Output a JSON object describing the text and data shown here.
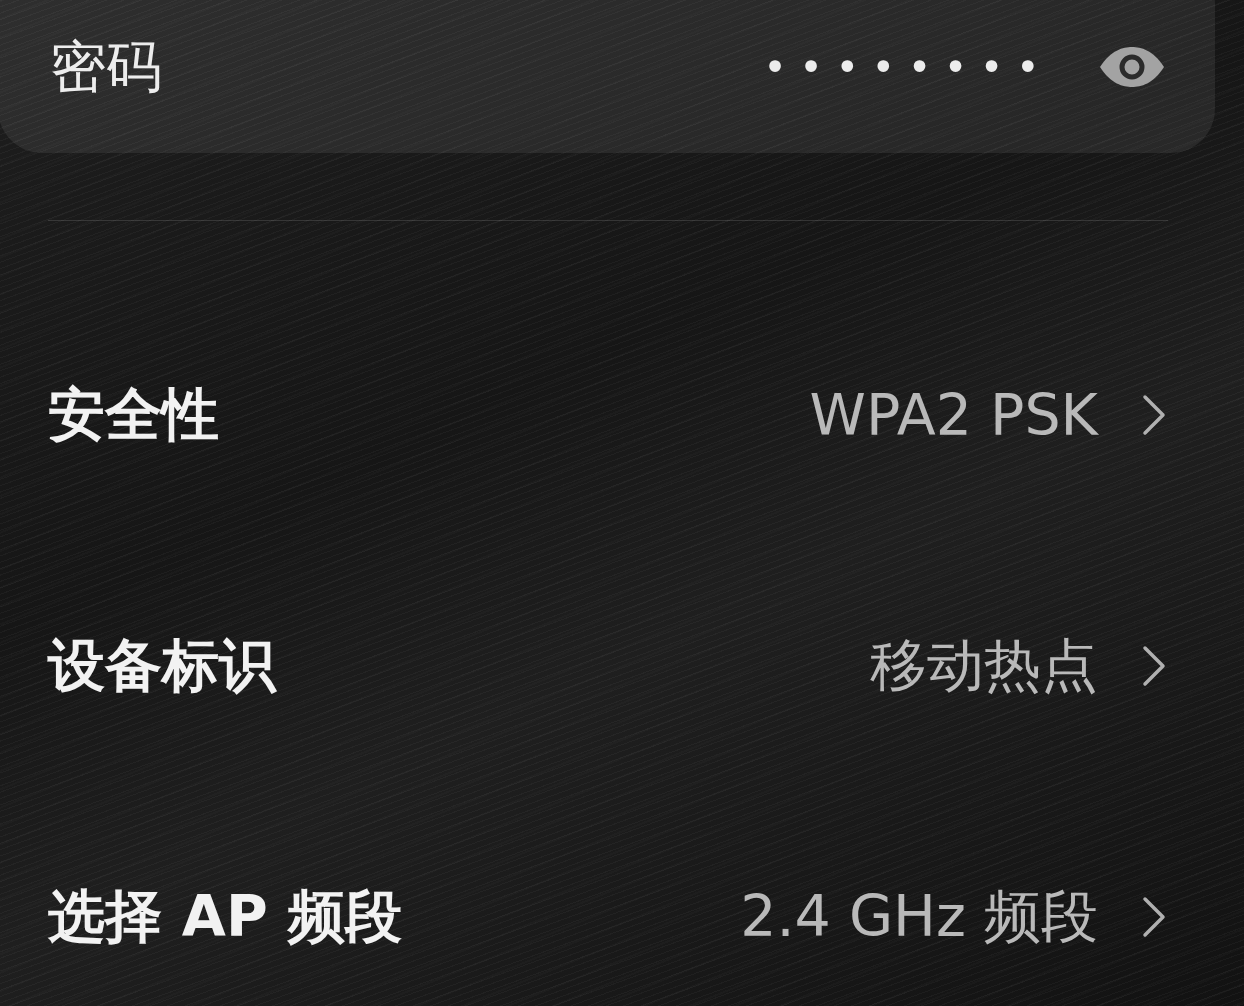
{
  "password_field": {
    "label": "密码",
    "value": "••••••••"
  },
  "settings": [
    {
      "label": "安全性",
      "value": "WPA2 PSK"
    },
    {
      "label": "设备标识",
      "value": "移动热点"
    },
    {
      "label": "选择 AP 频段",
      "value": "2.4 GHz 频段"
    }
  ]
}
